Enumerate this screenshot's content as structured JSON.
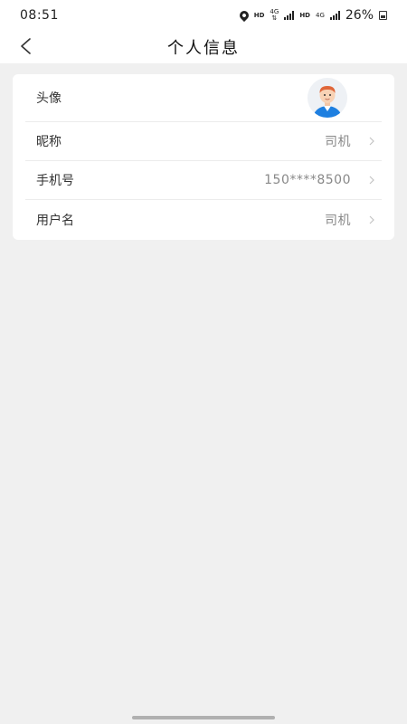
{
  "status_bar": {
    "time": "08:51",
    "hd1": "HD",
    "net1": "4G",
    "hd2": "HD",
    "net2": "4G",
    "battery": "26%",
    "icons": [
      "location-icon",
      "signal-icon",
      "battery-icon"
    ]
  },
  "header": {
    "title": "个人信息",
    "back_icon": "chevron-left-icon"
  },
  "profile": {
    "rows": [
      {
        "label": "头像",
        "value": "",
        "type": "avatar"
      },
      {
        "label": "昵称",
        "value": "司机"
      },
      {
        "label": "手机号",
        "value": "150****8500"
      },
      {
        "label": "用户名",
        "value": "司机"
      }
    ]
  },
  "colors": {
    "background": "#f0f0f0",
    "card": "#ffffff",
    "label_text": "#333333",
    "value_text": "#888888",
    "avatar_shirt": "#1e7fe0"
  }
}
